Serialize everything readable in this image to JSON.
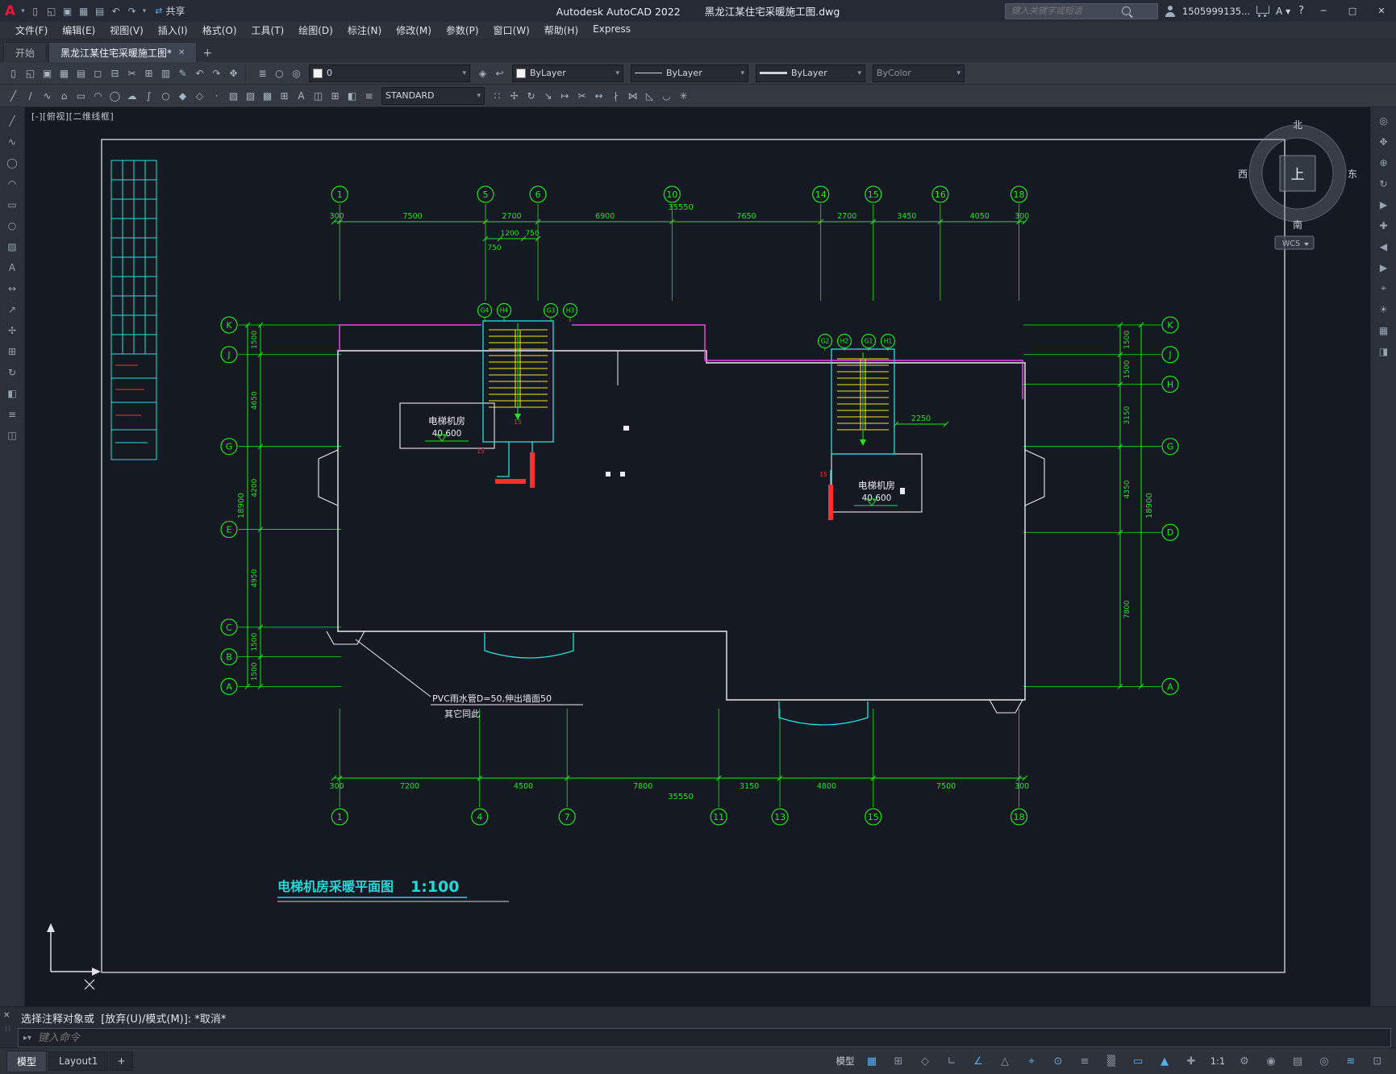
{
  "title_bar": {
    "logo": "A",
    "quick_access_icons": [
      "new",
      "open",
      "save",
      "save-as",
      "plot",
      "undo",
      "redo"
    ],
    "share_label": "共享",
    "app_title": "Autodesk AutoCAD 2022",
    "doc_title": "黑龙江某住宅采暖施工图.dwg",
    "search_placeholder": "键入关键字或短语",
    "account": "1505999135...",
    "help_label": "?",
    "minimize": "─",
    "maximize": "□",
    "close": "✕"
  },
  "menu_bar": {
    "items": [
      "文件(F)",
      "编辑(E)",
      "视图(V)",
      "插入(I)",
      "格式(O)",
      "工具(T)",
      "绘图(D)",
      "标注(N)",
      "修改(M)",
      "参数(P)",
      "窗口(W)",
      "帮助(H)",
      "Express"
    ]
  },
  "file_tabs": {
    "start_tab": "开始",
    "doc_tab": "黑龙江某住宅采暖施工图*",
    "close": "✕",
    "new_tab": "+"
  },
  "toolbar": {
    "row1_icons": [
      "new",
      "open",
      "save",
      "save-as",
      "plot",
      "plot-preview",
      "publish",
      "cut",
      "copy",
      "paste",
      "match-properties",
      "undo",
      "redo",
      "pan"
    ],
    "layer_tool_icons": [
      "layer-properties",
      "layer-off",
      "layer-isolate"
    ],
    "layer_combo_value": "0",
    "layer_extra_icons": [
      "make-object-layer-current",
      "layer-previous"
    ],
    "color_combo_value": "ByLayer",
    "linetype_combo_value": "ByLayer",
    "lineweight_combo_value": "ByLayer",
    "plotstyle_combo_value": "ByColor",
    "row2_icons": [
      "line",
      "construction-line",
      "polyline",
      "polygon",
      "rectangle",
      "arc",
      "circle",
      "revcloud",
      "spline",
      "ellipse",
      "insert-block",
      "make-block",
      "point",
      "hatch",
      "gradient",
      "region",
      "table",
      "multiline-text",
      "erase",
      "copy",
      "mirror",
      "offset"
    ],
    "style_combo_value": "STANDARD",
    "row2_right_icons": [
      "array",
      "move",
      "rotate",
      "scale",
      "stretch",
      "trim",
      "extend",
      "break",
      "join",
      "chamfer",
      "fillet",
      "explode"
    ]
  },
  "left_toolbar_icons": [
    "line",
    "polyline",
    "circle",
    "arc",
    "rectangle",
    "ellipse",
    "hatch",
    "text",
    "dimension",
    "leader",
    "move",
    "copy",
    "rotate",
    "mirror",
    "offset",
    "erase"
  ],
  "right_toolbar_icons": [
    "full-navigation-wheel",
    "pan",
    "zoom",
    "orbit",
    "show-motion",
    "steering",
    "view-back",
    "view-forward",
    "camera",
    "sun",
    "materials",
    "render"
  ],
  "canvas": {
    "viewport_label": "[-][俯视][二维线框]",
    "compass": {
      "north": "北",
      "south": "南",
      "east": "东",
      "west": "西",
      "top_face": "上",
      "wcs": "WCS"
    }
  },
  "plan": {
    "top_axis": {
      "bubbles": [
        "1",
        "5",
        "6",
        "10",
        "14",
        "15",
        "16",
        "18"
      ],
      "segments": [
        300,
        7500,
        2700,
        6900,
        7650,
        2700,
        3450,
        4050,
        300
      ],
      "sub_dims": [
        "750",
        "1200",
        "750"
      ],
      "total": "35550"
    },
    "bottom_axis": {
      "bubbles": [
        "1",
        "4",
        "7",
        "11",
        "13",
        "15",
        "18"
      ],
      "segments": [
        300,
        7200,
        4500,
        7800,
        3150,
        4800,
        7500,
        300
      ],
      "total": "35550"
    },
    "left_axis": {
      "bubbles": [
        "K",
        "J",
        "G",
        "E",
        "C",
        "B",
        "A"
      ],
      "segments": [
        1500,
        4650,
        4200,
        4950,
        1500,
        1500
      ],
      "total": "18900"
    },
    "right_axis": {
      "bubbles": [
        "K",
        "J",
        "H",
        "G",
        "D",
        "A"
      ],
      "segments": [
        1500,
        1500,
        3150,
        4350,
        7800
      ],
      "total": "18900"
    },
    "stair_bubbles_left": [
      "G4",
      "H4",
      "G3",
      "H3"
    ],
    "stair_bubbles_right": [
      "G2",
      "H2",
      "G1",
      "H1"
    ],
    "labels": {
      "elevator_room": "电梯机房",
      "elevation": "40.600",
      "stair_dim": "2250",
      "radiator_tag": "15",
      "pvc_note_line1": "PVC雨水管D=50,伸出墙面50",
      "pvc_note_line2": "其它同此",
      "drawing_title": "电梯机房采暖平面图",
      "drawing_scale": "1:100"
    },
    "colors": {
      "axis_green": "#1fe41f",
      "wall_white": "#e9ebee",
      "supply_magenta": "#f040f0",
      "return_cyan": "#29e0e0",
      "stair_yellow": "#f2e41c",
      "radiator_red": "#ff3030",
      "title_cyan": "#25d8d8"
    }
  },
  "command": {
    "history": "选择注释对象或  [放弃(U)/模式(M)]: *取消*",
    "prompt": "键入命令"
  },
  "status_bar": {
    "model_tab": "模型",
    "layout_tab": "Layout1",
    "new_layout": "+",
    "right_items": [
      {
        "name": "model-space",
        "label": "模型",
        "active": false
      },
      {
        "name": "grid",
        "active": true
      },
      {
        "name": "snap-mode",
        "active": false
      },
      {
        "name": "infer-constraints",
        "active": false
      },
      {
        "name": "ortho",
        "active": false
      },
      {
        "name": "polar-tracking",
        "active": true
      },
      {
        "name": "isodraft",
        "active": false
      },
      {
        "name": "object-snap-tracking",
        "active": true
      },
      {
        "name": "object-snap",
        "active": true
      },
      {
        "name": "lineweight",
        "active": false
      },
      {
        "name": "transparency",
        "active": false
      },
      {
        "name": "dynamic-input",
        "active": true
      },
      {
        "name": "annotation-visibility",
        "active": true
      },
      {
        "name": "autoscale",
        "active": false
      },
      {
        "name": "annotation-scale",
        "label": "1:1",
        "active": false
      },
      {
        "name": "workspace-switching",
        "active": false
      },
      {
        "name": "annotation-monitor",
        "active": false
      },
      {
        "name": "quick-properties",
        "active": false
      },
      {
        "name": "isolate-objects",
        "active": false
      },
      {
        "name": "graphics-performance",
        "active": true
      },
      {
        "name": "clean-screen",
        "active": false
      }
    ]
  }
}
